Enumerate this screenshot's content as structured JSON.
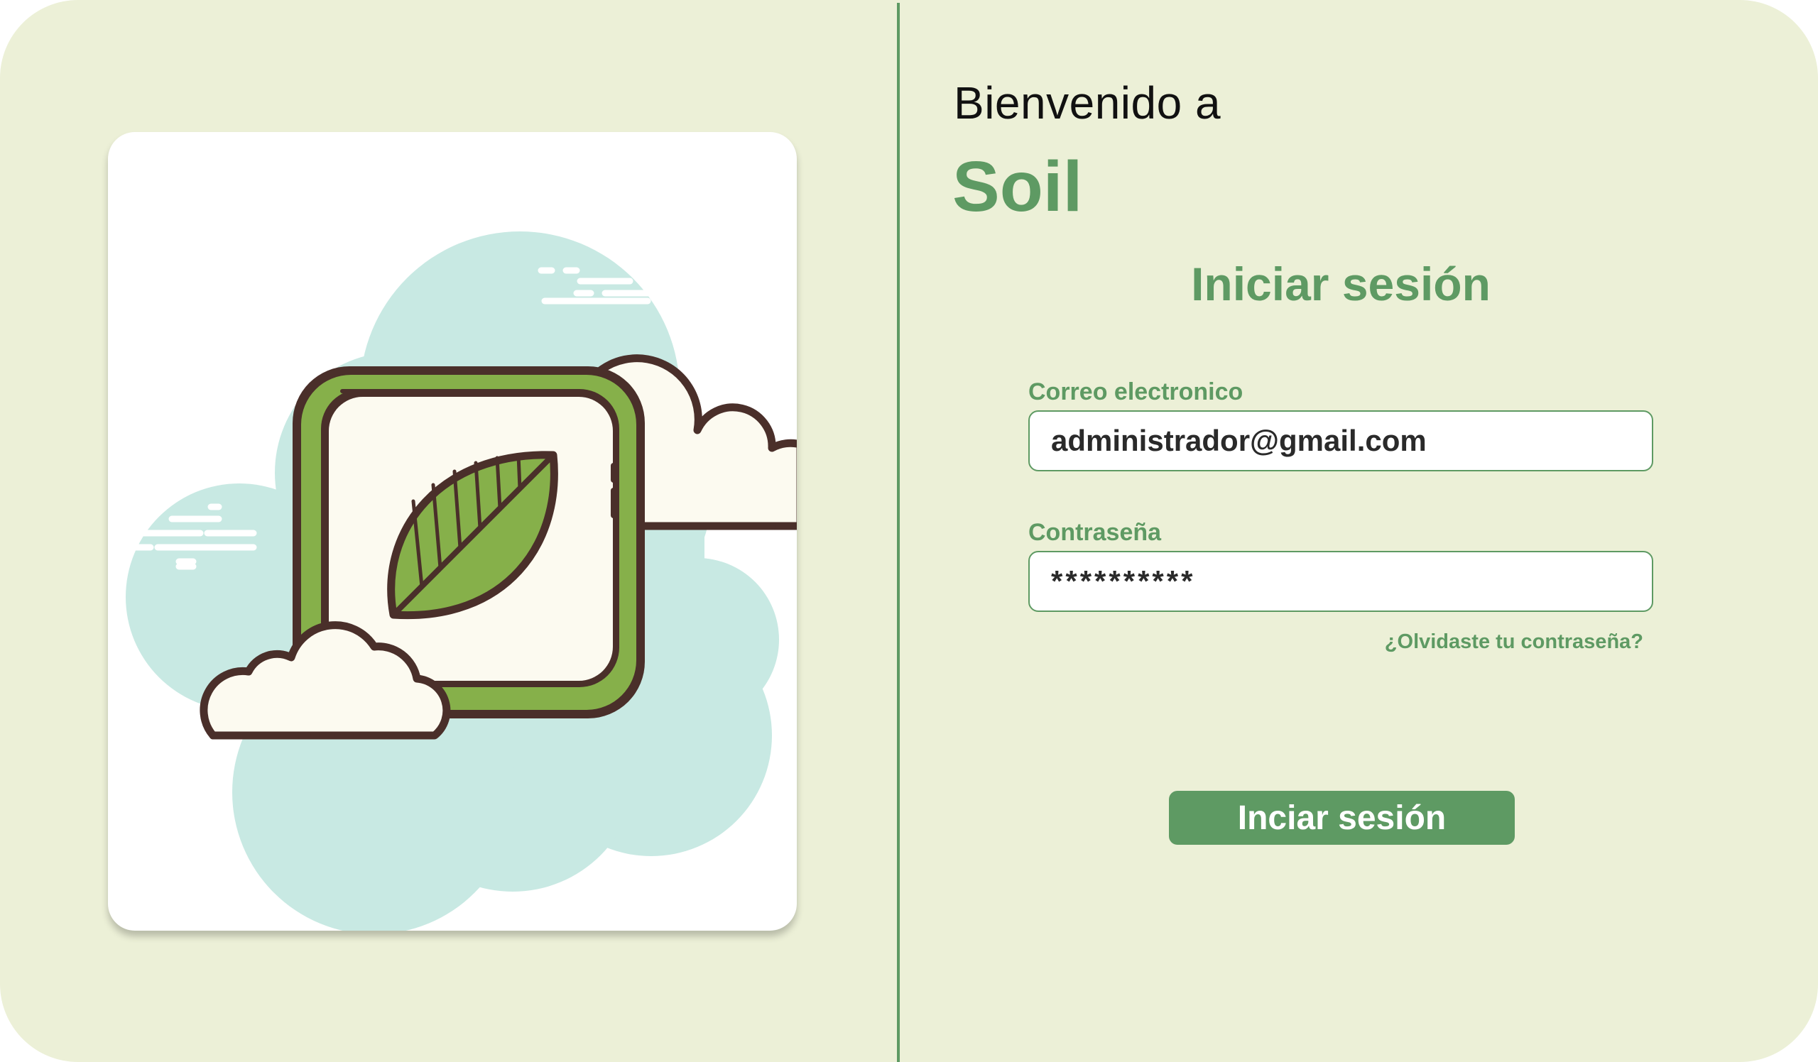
{
  "header": {
    "welcome_text": "Bienvenido a",
    "brand_name": "Soil"
  },
  "login": {
    "title": "Iniciar sesión",
    "email_label": "Correo electronico",
    "email_value": "administrador@gmail.com",
    "password_label": "Contraseña",
    "password_value": "**********",
    "forgot_password": "¿Olvidaste tu contraseña?",
    "submit_label": "Inciar sesión"
  },
  "illustration": {
    "icon": "leaf-app-icon"
  },
  "colors": {
    "background": "#ecf0d7",
    "accent": "#5e9a63",
    "leaf_green": "#86b04a",
    "cloud_blue": "#c8e9e3",
    "outline": "#4a2f2a"
  }
}
